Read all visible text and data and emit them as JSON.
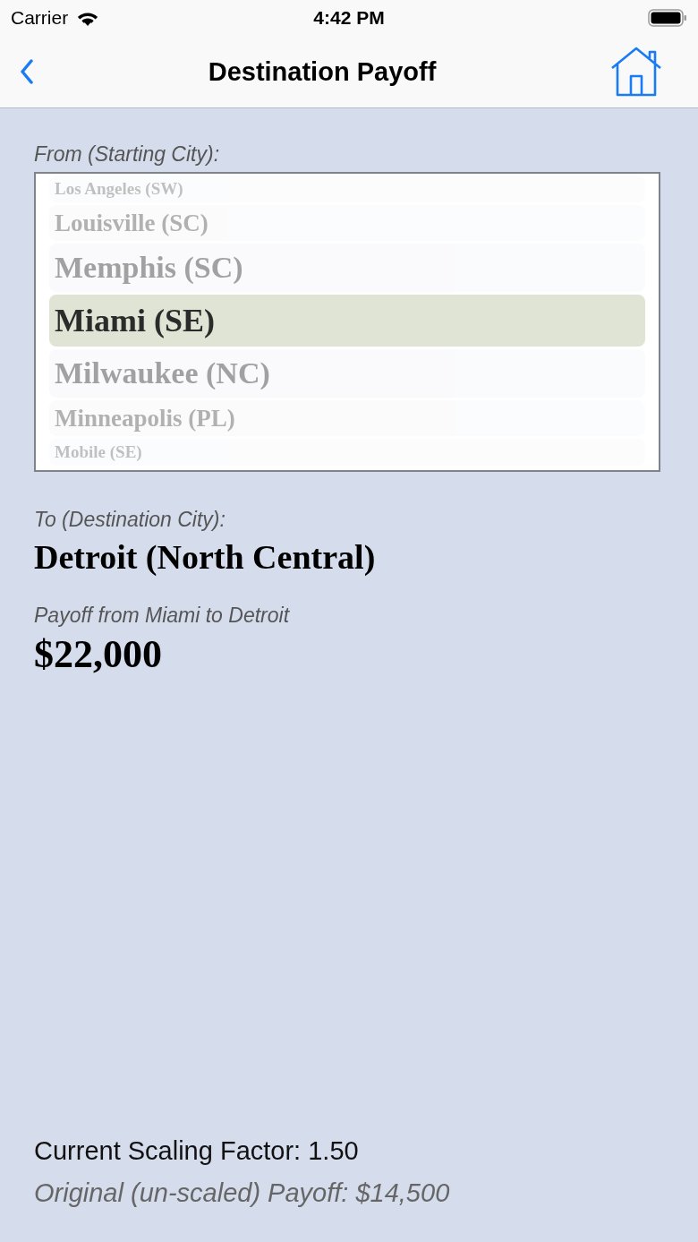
{
  "status_bar": {
    "carrier": "Carrier",
    "time": "4:42 PM"
  },
  "nav_bar": {
    "title": "Destination Payoff"
  },
  "from": {
    "label": "From (Starting City):",
    "options": [
      {
        "label": "Los Angeles (SW)",
        "selected": false
      },
      {
        "label": "Louisville (SC)",
        "selected": false
      },
      {
        "label": "Memphis (SC)",
        "selected": false
      },
      {
        "label": "Miami (SE)",
        "selected": true
      },
      {
        "label": "Milwaukee (NC)",
        "selected": false
      },
      {
        "label": "Minneapolis (PL)",
        "selected": false
      },
      {
        "label": "Mobile (SE)",
        "selected": false
      }
    ]
  },
  "to": {
    "label": "To (Destination City):",
    "value": "Detroit (North Central)"
  },
  "payoff": {
    "label": "Payoff from Miami to Detroit",
    "value": "$22,000"
  },
  "footer": {
    "scaling": "Current Scaling Factor: 1.50",
    "original": "Original (un-scaled) Payoff: $14,500"
  }
}
